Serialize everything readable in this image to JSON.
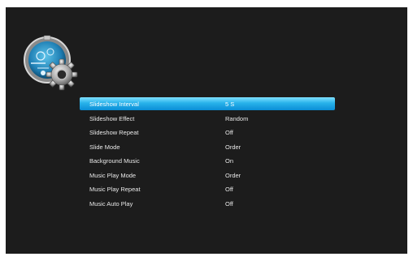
{
  "menu": {
    "items": [
      {
        "label": "Slideshow Interval",
        "value": "5 S",
        "selected": true
      },
      {
        "label": "Slideshow Effect",
        "value": "Random"
      },
      {
        "label": "Slideshow Repeat",
        "value": "Off"
      },
      {
        "label": "Slide Mode",
        "value": "Order"
      },
      {
        "label": "Background Music",
        "value": "On"
      },
      {
        "label": "Music Play Mode",
        "value": "Order"
      },
      {
        "label": "Music Play Repeat",
        "value": "Off"
      },
      {
        "label": "Music Auto Play",
        "value": "Off"
      }
    ]
  },
  "colors": {
    "background": "#1c1c1c",
    "highlight": "#28b2ea",
    "text": "#e8e8e8"
  },
  "icons": {
    "logo": "settings-gear-icon"
  }
}
